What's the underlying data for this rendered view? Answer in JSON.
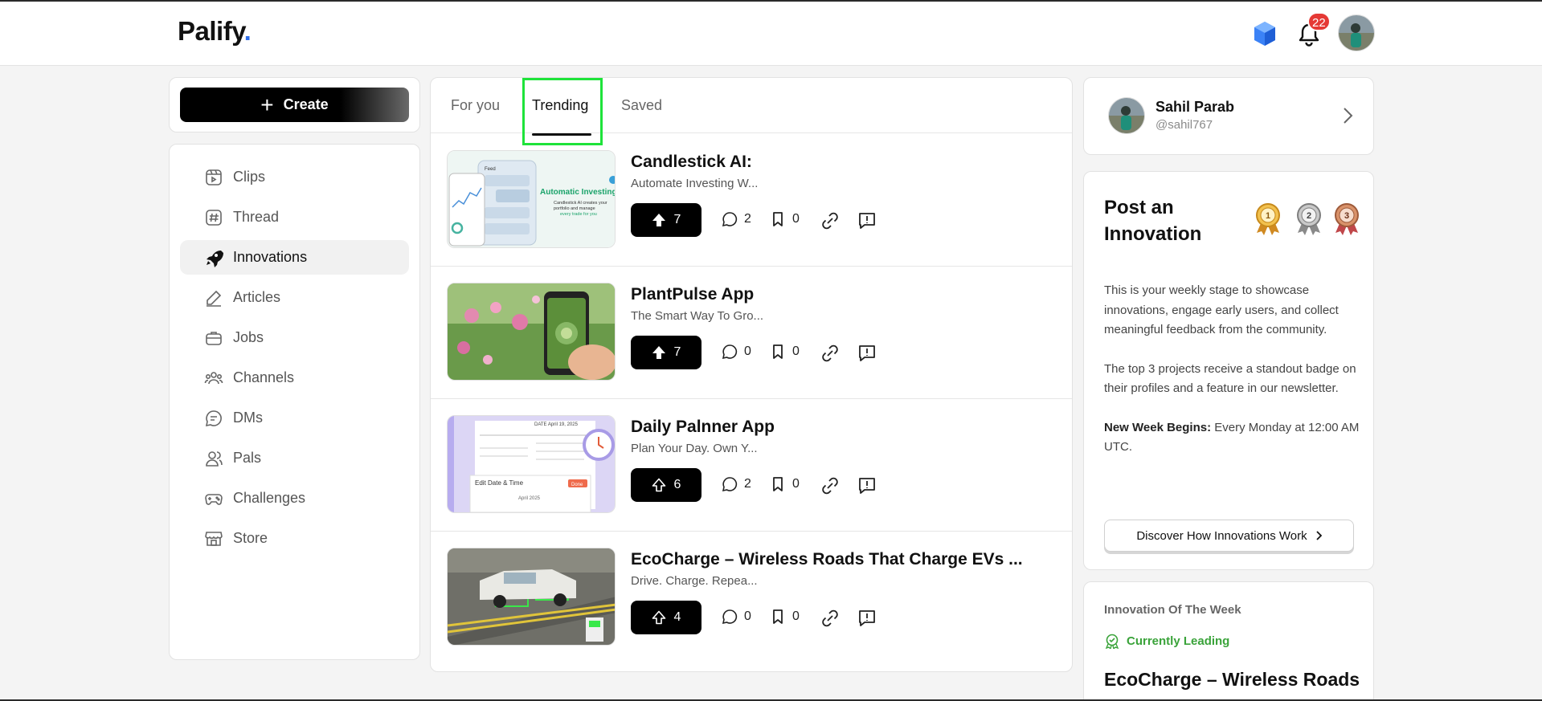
{
  "header": {
    "logo_text": "Palify",
    "logo_dot": ".",
    "notification_count": "22"
  },
  "sidebar": {
    "create_label": "Create",
    "items": [
      {
        "label": "Clips",
        "icon": "clips-icon"
      },
      {
        "label": "Thread",
        "icon": "hash-icon"
      },
      {
        "label": "Innovations",
        "icon": "rocket-icon",
        "active": true
      },
      {
        "label": "Articles",
        "icon": "pen-icon"
      },
      {
        "label": "Jobs",
        "icon": "briefcase-icon"
      },
      {
        "label": "Channels",
        "icon": "people-icon"
      },
      {
        "label": "DMs",
        "icon": "chat-icon"
      },
      {
        "label": "Pals",
        "icon": "pals-icon"
      },
      {
        "label": "Challenges",
        "icon": "gamepad-icon"
      },
      {
        "label": "Store",
        "icon": "store-icon"
      }
    ]
  },
  "feed": {
    "tabs": [
      {
        "label": "For you"
      },
      {
        "label": "Trending",
        "active": true
      },
      {
        "label": "Saved"
      }
    ],
    "posts": [
      {
        "title": "Candlestick AI:",
        "subtitle": "Automate Investing W...",
        "upvotes": "7",
        "comments": "2",
        "saves": "0",
        "upvoted": true
      },
      {
        "title": "PlantPulse App",
        "subtitle": "The Smart Way To Gro...",
        "upvotes": "7",
        "comments": "0",
        "saves": "0",
        "upvoted": true
      },
      {
        "title": "Daily Palnner App",
        "subtitle": "Plan Your Day. Own Y...",
        "upvotes": "6",
        "comments": "2",
        "saves": "0",
        "upvoted": false
      },
      {
        "title": "EcoCharge – Wireless Roads That Charge EVs ...",
        "subtitle": "Drive. Charge. Repea...",
        "upvotes": "4",
        "comments": "0",
        "saves": "0",
        "upvoted": false
      }
    ],
    "thumb_texts": {
      "candlestick_feed": "Feed",
      "candlestick_headline": "Automatic Investing",
      "candlestick_body": "Candlestick AI creates your portfolio and manage every trade for you",
      "planner_date": "DATE April 19, 2025",
      "planner_edit": "Edit Date & Time",
      "planner_done": "Done",
      "planner_month": "April 2025"
    }
  },
  "profile": {
    "name": "Sahil Parab",
    "handle": "@sahil767"
  },
  "post_innovation": {
    "title": "Post an Innovation",
    "para1": "This is your weekly stage to showcase innovations, engage early users, and collect meaningful feedback from the community.",
    "para2": "The top 3 projects receive a standout badge on their profiles and a feature in our newsletter.",
    "week_label": "New Week Begins:",
    "week_value": " Every Monday at 12:00 AM UTC.",
    "button_label": "Discover How Innovations Work",
    "medals": [
      "1",
      "2",
      "3"
    ]
  },
  "innovation_of_week": {
    "label": "Innovation Of The Week",
    "status": "Currently Leading",
    "title": "EcoCharge – Wireless Roads"
  },
  "colors": {
    "accent_blue": "#2f6ee8",
    "badge_red": "#e53935",
    "highlight_green": "#1ee33a",
    "leading_green": "#3aa33a"
  }
}
